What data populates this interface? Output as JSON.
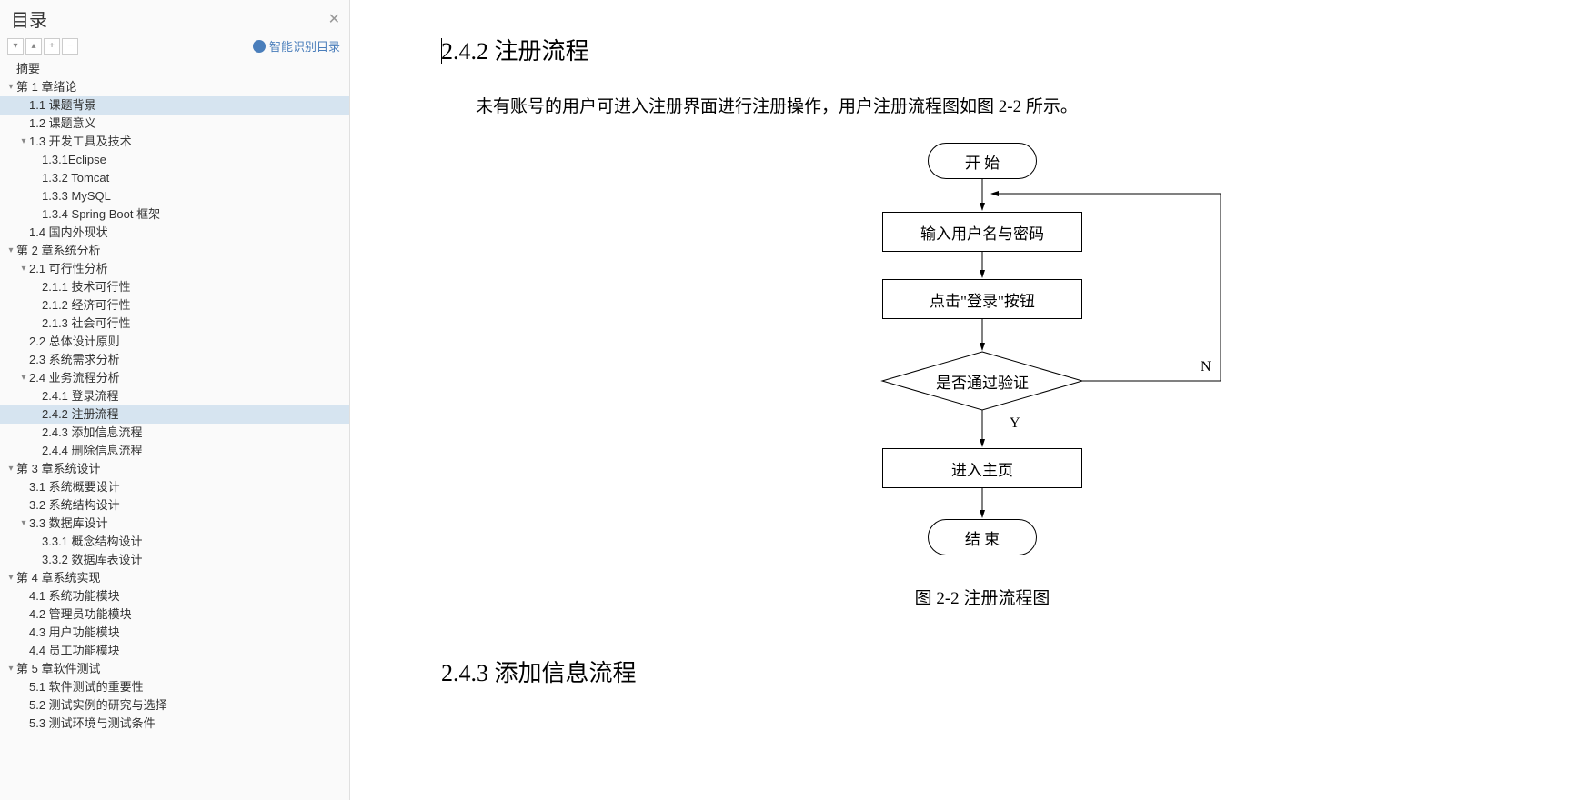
{
  "sidebar": {
    "title": "目录",
    "smart_recognition": "智能识别目录",
    "toolbar_icons": [
      "expand-down",
      "collapse-up",
      "add",
      "remove"
    ],
    "tree": [
      {
        "label": "摘要",
        "level": 0,
        "chev": ""
      },
      {
        "label": "第 1 章绪论",
        "level": 0,
        "chev": "v"
      },
      {
        "label": "1.1 课题背景",
        "level": 1,
        "chev": "",
        "selected": true
      },
      {
        "label": "1.2 课题意义",
        "level": 1,
        "chev": ""
      },
      {
        "label": "1.3 开发工具及技术",
        "level": 1,
        "chev": "v"
      },
      {
        "label": "1.3.1Eclipse",
        "level": 2,
        "chev": ""
      },
      {
        "label": "1.3.2 Tomcat",
        "level": 2,
        "chev": ""
      },
      {
        "label": "1.3.3 MySQL",
        "level": 2,
        "chev": ""
      },
      {
        "label": "1.3.4 Spring Boot 框架",
        "level": 2,
        "chev": ""
      },
      {
        "label": "1.4 国内外现状",
        "level": 1,
        "chev": ""
      },
      {
        "label": "第 2 章系统分析",
        "level": 0,
        "chev": "v"
      },
      {
        "label": "2.1 可行性分析",
        "level": 1,
        "chev": "v"
      },
      {
        "label": "2.1.1 技术可行性",
        "level": 2,
        "chev": ""
      },
      {
        "label": "2.1.2 经济可行性",
        "level": 2,
        "chev": ""
      },
      {
        "label": "2.1.3 社会可行性",
        "level": 2,
        "chev": ""
      },
      {
        "label": "2.2 总体设计原则",
        "level": 1,
        "chev": ""
      },
      {
        "label": "2.3 系统需求分析",
        "level": 1,
        "chev": ""
      },
      {
        "label": "2.4 业务流程分析",
        "level": 1,
        "chev": "v"
      },
      {
        "label": "2.4.1 登录流程",
        "level": 2,
        "chev": ""
      },
      {
        "label": "2.4.2 注册流程",
        "level": 2,
        "chev": "",
        "active": true
      },
      {
        "label": "2.4.3 添加信息流程",
        "level": 2,
        "chev": ""
      },
      {
        "label": "2.4.4 删除信息流程",
        "level": 2,
        "chev": ""
      },
      {
        "label": "第 3 章系统设计",
        "level": 0,
        "chev": "v"
      },
      {
        "label": "3.1 系统概要设计",
        "level": 1,
        "chev": ""
      },
      {
        "label": "3.2 系统结构设计",
        "level": 1,
        "chev": ""
      },
      {
        "label": "3.3 数据库设计",
        "level": 1,
        "chev": "v"
      },
      {
        "label": "3.3.1 概念结构设计",
        "level": 2,
        "chev": ""
      },
      {
        "label": "3.3.2 数据库表设计",
        "level": 2,
        "chev": ""
      },
      {
        "label": "第 4 章系统实现",
        "level": 0,
        "chev": "v"
      },
      {
        "label": "4.1 系统功能模块",
        "level": 1,
        "chev": ""
      },
      {
        "label": "4.2 管理员功能模块",
        "level": 1,
        "chev": ""
      },
      {
        "label": "4.3 用户功能模块",
        "level": 1,
        "chev": ""
      },
      {
        "label": "4.4 员工功能模块",
        "level": 1,
        "chev": ""
      },
      {
        "label": "第 5 章软件测试",
        "level": 0,
        "chev": "v"
      },
      {
        "label": "5.1 软件测试的重要性",
        "level": 1,
        "chev": ""
      },
      {
        "label": "5.2 测试实例的研究与选择",
        "level": 1,
        "chev": ""
      },
      {
        "label": "5.3 测试环境与测试条件",
        "level": 1,
        "chev": ""
      }
    ]
  },
  "doc": {
    "heading_242": "2.4.2 注册流程",
    "para_242": "未有账号的用户可进入注册界面进行注册操作，用户注册流程图如图 2-2 所示。",
    "flow": {
      "start": "开 始",
      "input": "输入用户名与密码",
      "click": "点击\"登录\"按钮",
      "decision": "是否通过验证",
      "yes": "Y",
      "no": "N",
      "home": "进入主页",
      "end": "结 束"
    },
    "caption": "图 2-2 注册流程图",
    "heading_243": "2.4.3 添加信息流程"
  }
}
